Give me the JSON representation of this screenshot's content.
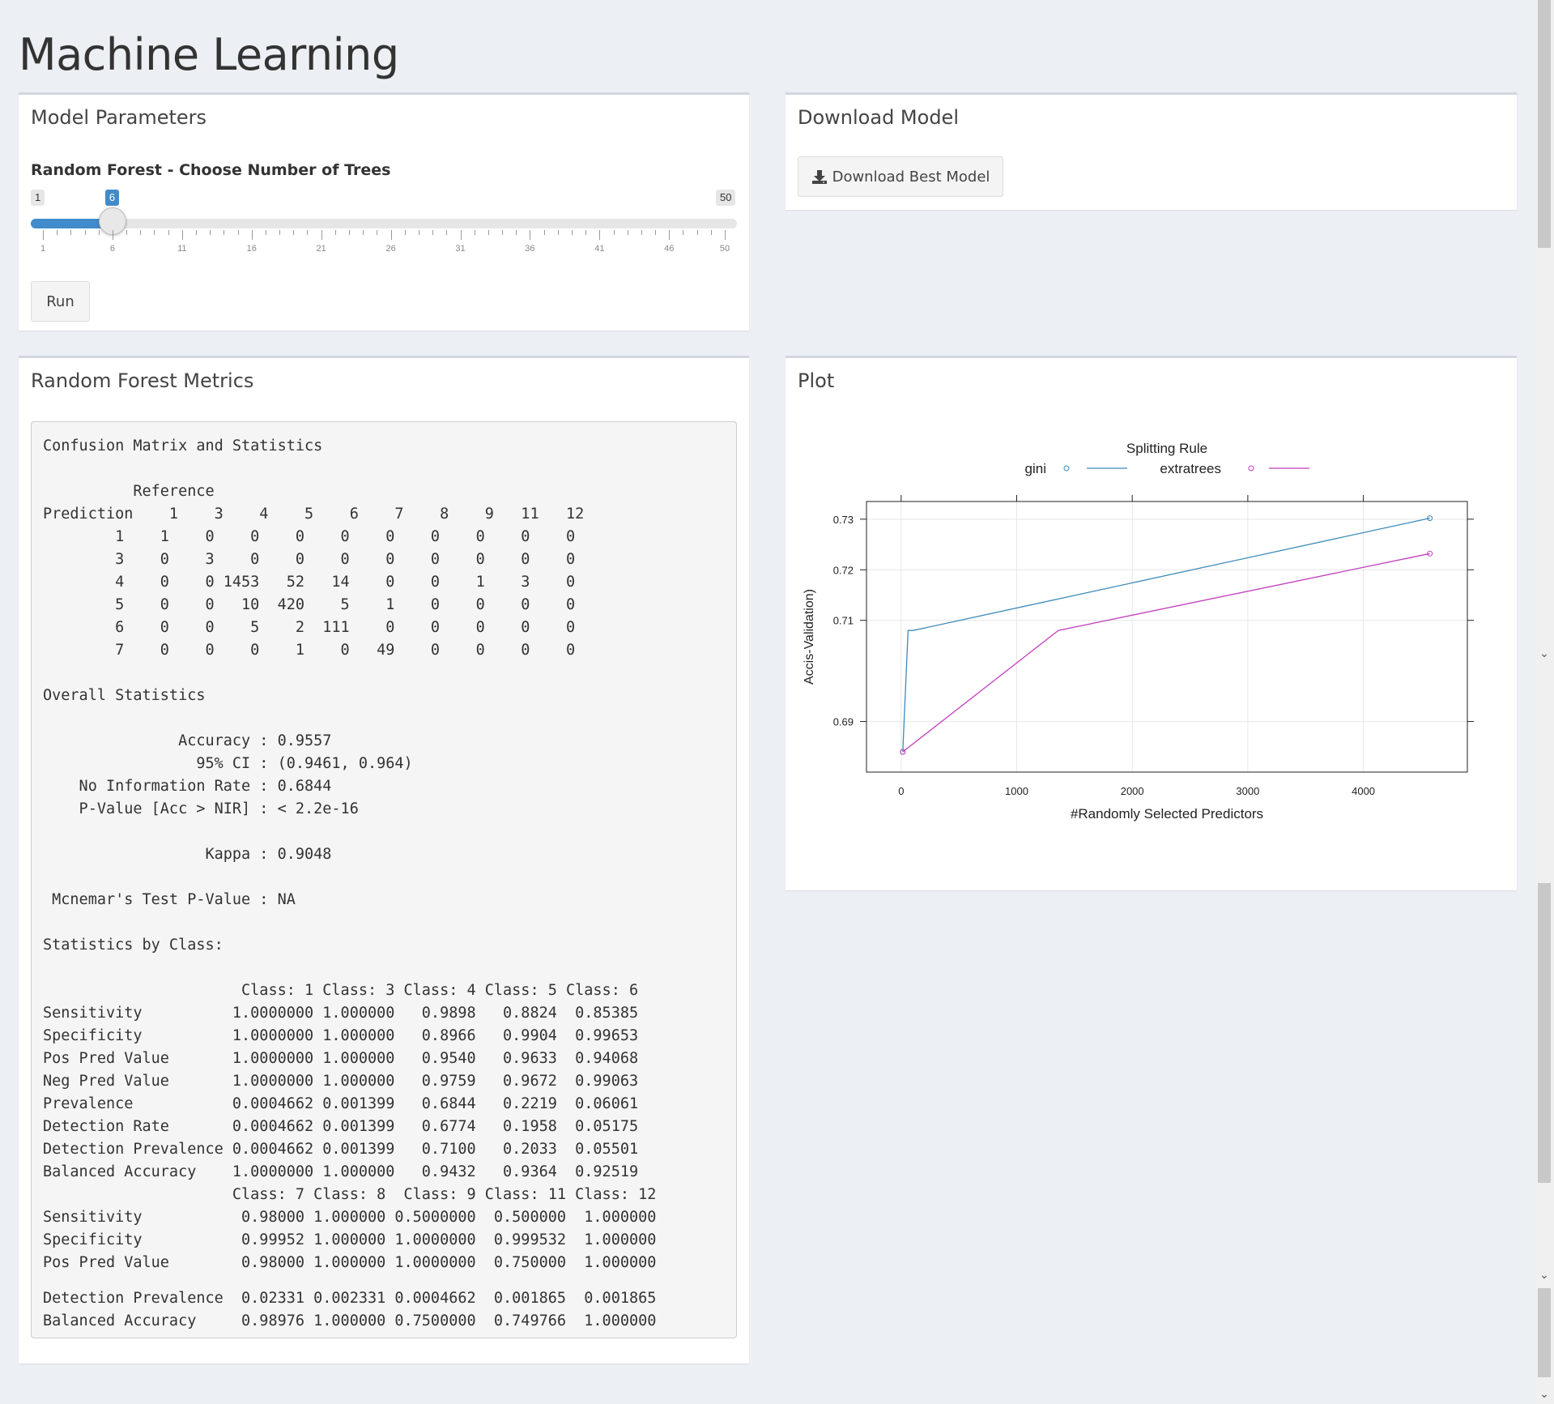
{
  "page": {
    "title": "Machine Learning"
  },
  "params_box": {
    "title": "Model Parameters",
    "slider": {
      "label": "Random Forest - Choose Number of Trees",
      "min": 1,
      "max": 50,
      "value": 6,
      "min_label": "1",
      "max_label": "50",
      "value_label": "6",
      "tick_labels": [
        "1",
        "6",
        "11",
        "16",
        "21",
        "26",
        "31",
        "36",
        "41",
        "46",
        "50"
      ]
    },
    "run_label": "Run"
  },
  "download_box": {
    "title": "Download Model",
    "button_label": "Download Best Model",
    "button_icon": "download-icon"
  },
  "metrics_box": {
    "title": "Random Forest Metrics",
    "output_main": "Confusion Matrix and Statistics\n\n          Reference\nPrediction    1    3    4    5    6    7    8    9   11   12\n        1    1    0    0    0    0    0    0    0    0    0\n        3    0    3    0    0    0    0    0    0    0    0\n        4    0    0 1453   52   14    0    0    1    3    0\n        5    0    0   10  420    5    1    0    0    0    0\n        6    0    0    5    2  111    0    0    0    0    0\n        7    0    0    0    1    0   49    0    0    0    0\n\nOverall Statistics\n\n               Accuracy : 0.9557\n                 95% CI : (0.9461, 0.964)\n    No Information Rate : 0.6844\n    P-Value [Acc > NIR] : < 2.2e-16\n\n                  Kappa : 0.9048\n\n Mcnemar's Test P-Value : NA\n\nStatistics by Class:\n\n                      Class: 1 Class: 3 Class: 4 Class: 5 Class: 6\nSensitivity          1.0000000 1.000000   0.9898   0.8824  0.85385\nSpecificity          1.0000000 1.000000   0.8966   0.9904  0.99653\nPos Pred Value       1.0000000 1.000000   0.9540   0.9633  0.94068\nNeg Pred Value       1.0000000 1.000000   0.9759   0.9672  0.99063\nPrevalence           0.0004662 0.001399   0.6844   0.2219  0.06061\nDetection Rate       0.0004662 0.001399   0.6774   0.1958  0.05175\nDetection Prevalence 0.0004662 0.001399   0.7100   0.2033  0.05501\nBalanced Accuracy    1.0000000 1.000000   0.9432   0.9364  0.92519\n                     Class: 7 Class: 8  Class: 9 Class: 11 Class: 12\nSensitivity           0.98000 1.000000 0.5000000  0.500000  1.000000\nSpecificity           0.99952 1.000000 1.0000000  0.999532  1.000000\nPos Pred Value        0.98000 1.000000 1.0000000  0.750000  1.000000",
    "output_tail": "Detection Prevalence  0.02331 0.002331 0.0004662  0.001865  0.001865\nBalanced Accuracy     0.98976 1.000000 0.7500000  0.749766  1.000000"
  },
  "plot_box": {
    "title": "Plot",
    "chart_data": {
      "type": "line",
      "legend_title": "Splitting Rule",
      "legend_placement": "top",
      "xlabel": "#Randomly Selected Predictors",
      "ylabel": "Accis-Validation)",
      "xlim": [
        -300,
        4900
      ],
      "ylim": [
        0.68,
        0.7335
      ],
      "x_ticks": [
        0,
        1000,
        2000,
        3000,
        4000
      ],
      "x_tick_labels": [
        "0",
        "1000",
        "2000",
        "3000",
        "4000"
      ],
      "y_ticks": [
        0.69,
        0.71,
        0.72,
        0.73
      ],
      "y_tick_labels": [
        "0.69",
        "0.71",
        "0.72",
        "0.73"
      ],
      "grid": true,
      "series": [
        {
          "name": "gini",
          "color": "#3d8ab9",
          "x": [
            14,
            60,
            105,
            4575
          ],
          "y": [
            0.684,
            0.708,
            0.708,
            0.7302
          ]
        },
        {
          "name": "extratrees",
          "color": "#c23fbe",
          "x": [
            14,
            1360,
            4575
          ],
          "y": [
            0.684,
            0.708,
            0.7232
          ]
        }
      ]
    }
  },
  "colors": {
    "accent": "#428bca",
    "box_border": "#d2d6de",
    "background": "#eceff3"
  }
}
